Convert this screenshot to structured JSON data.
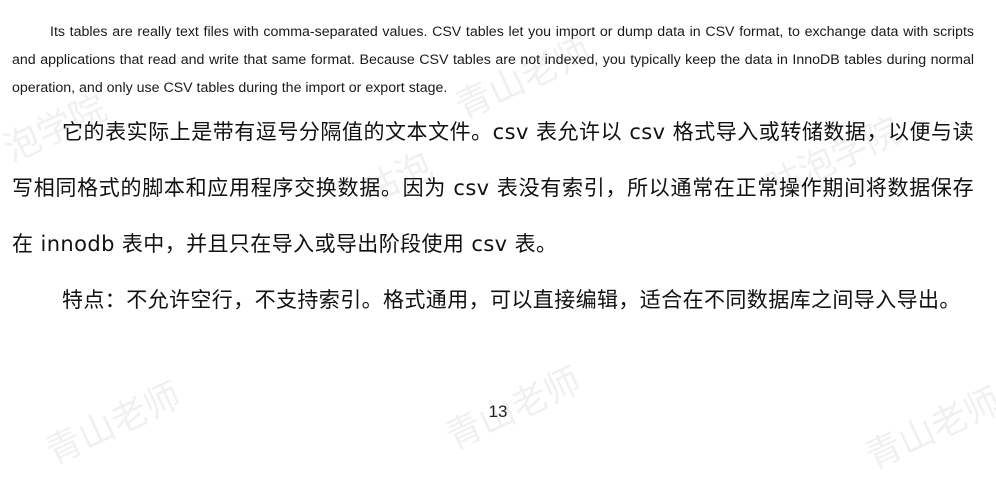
{
  "document": {
    "english_paragraph": "Its tables are really text files with comma-separated values. CSV tables let you import or dump data in CSV format, to exchange data with scripts and applications that read and write that same format. Because CSV tables are not indexed, you typically keep the data in InnoDB tables during normal operation, and only use CSV tables during the import or export stage.",
    "chinese_paragraph_1": "它的表实际上是带有逗号分隔值的文本文件。csv 表允许以 csv 格式导入或转储数据，以便与读写相同格式的脚本和应用程序交换数据。因为 csv 表没有索引，所以通常在正常操作期间将数据保存在 innodb 表中，并且只在导入或导出阶段使用 csv 表。",
    "chinese_paragraph_2": "特点：不允许空行，不支持索引。格式通用，可以直接编辑，适合在不同数据库之间导入导出。",
    "page_number": "13"
  },
  "watermark": {
    "text_1": "泡学院",
    "text_2": "咕泡",
    "text_3": "青山老师",
    "text_4": "咕泡学院",
    "text_5": "青山老师",
    "text_6": "青山老师",
    "text_7": "青山老师"
  }
}
